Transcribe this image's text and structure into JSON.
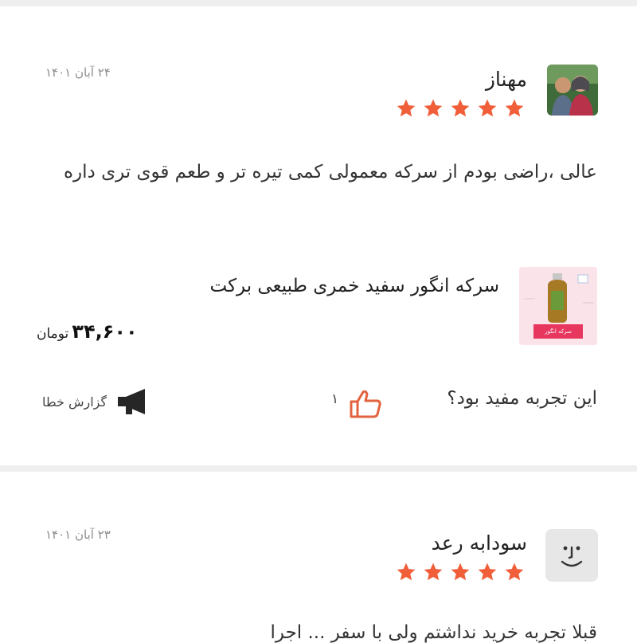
{
  "reviews": [
    {
      "author": "مهناز",
      "date": "۲۴ آبان ۱۴۰۱",
      "rating": 5,
      "body": "عالی ،راضی بودم از سرکه معمولی کمی تیره تر و طعم قوی تری داره",
      "product": {
        "name": "سرکه انگور سفید خمری طبیعی برکت",
        "image_label": "سرکه انگور",
        "price": "۳۴,۶۰۰",
        "currency": "تومان"
      },
      "helpful_question": "این تجربه مفید بود؟",
      "like_count": "۱",
      "report_label": "گزارش خطا"
    },
    {
      "author": "سودابه رعد",
      "date": "۲۳ آبان ۱۴۰۱",
      "rating": 5,
      "body_preview": "قبلا تجربه خرید نداشتم ولی با سفر ... اجرا"
    }
  ],
  "colors": {
    "star": "#f15f3a",
    "like": "#e3633f",
    "separator": "#efefef",
    "date": "#8d8d8d"
  },
  "icons": {
    "rating": "star-icon",
    "like": "thumbs-up-icon",
    "report": "megaphone-icon",
    "default_avatar": "smiley-face-icon"
  }
}
